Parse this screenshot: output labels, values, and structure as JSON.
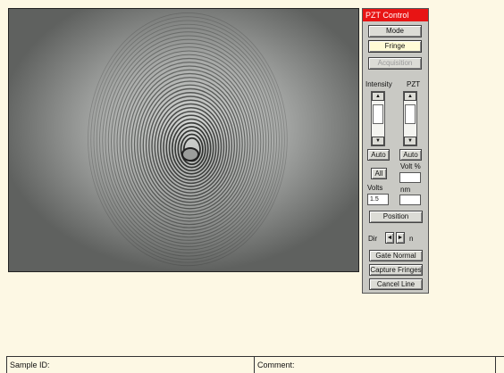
{
  "panel": {
    "title": "PZT Control",
    "mode_label": "Mode",
    "fringe_label": "Fringe",
    "disabled_label": "Acquisition",
    "intensity_label": "Intensity",
    "pzt_label": "PZT",
    "auto_left": "Auto",
    "auto_right": "Auto",
    "all_label": "All",
    "volts_pct_label": "Volt %",
    "volts_pct_value": "",
    "volts_label": "Volts",
    "volts_value": "1.5",
    "nm_label": "nm",
    "nm_value": "",
    "position_label": "Position",
    "dir_label": "Dir",
    "dir_left": "◄",
    "dir_right": "►",
    "dir_suffix": "n",
    "gate_normal": "Gate Normal",
    "capture_fringes": "Capture Fringes",
    "cancel_line": "Cancel Line"
  },
  "status_bar": {
    "sample_id_label": "Sample ID:",
    "comment_label": "Comment:"
  },
  "colors": {
    "title_bar": "#e81414",
    "background": "#fdf8e4",
    "panel": "#c9c9c4"
  }
}
